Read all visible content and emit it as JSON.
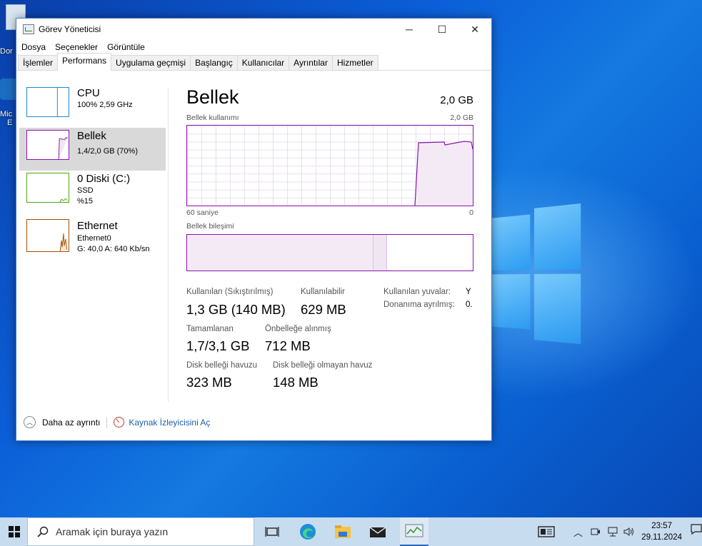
{
  "desktop": {
    "icon1_label": "Dor",
    "icon2_label": "Mic",
    "icon2_label2": "E"
  },
  "window": {
    "title": "Görev Yöneticisi",
    "controls": {
      "minimize": "─",
      "maximize": "☐",
      "close": "✕"
    }
  },
  "menu": [
    "Dosya",
    "Seçenekler",
    "Görüntüle"
  ],
  "tabs": [
    "İşlemler",
    "Performans",
    "Uygulama geçmişi",
    "Başlangıç",
    "Kullanıcılar",
    "Ayrıntılar",
    "Hizmetler"
  ],
  "active_tab": "Performans",
  "sidebar": [
    {
      "name": "CPU",
      "sub1": "100%  2,59 GHz",
      "sub2": "",
      "color": "#1a8ccc"
    },
    {
      "name": "Bellek",
      "sub1": "1,4/2,0 GB (70%)",
      "sub2": "",
      "color": "#8b12ae"
    },
    {
      "name": "0 Diski (C:)",
      "sub1": "SSD",
      "sub2": "%15",
      "color": "#4da60c"
    },
    {
      "name": "Ethernet",
      "sub1": "Ethernet0",
      "sub2": "G: 40,0  A: 640 Kb/sn",
      "color": "#a74f01"
    }
  ],
  "main": {
    "title": "Bellek",
    "capacity": "2,0 GB",
    "usage_label": "Bellek kullanımı",
    "usage_max": "2,0 GB",
    "x_left": "60 saniye",
    "x_right": "0",
    "composition_label": "Bellek bileşimi",
    "stats": [
      {
        "label": "Kullanılan (Sıkıştırılmış)",
        "value": "1,3 GB (140 MB)"
      },
      {
        "label": "Kullanılabilir",
        "value": "629 MB"
      },
      {
        "label": "Tamamlanan",
        "value": "1,7/3,1 GB"
      },
      {
        "label": "Önbelleğe alınmış",
        "value": "712 MB"
      },
      {
        "label": "Disk belleği havuzu",
        "value": "323 MB"
      },
      {
        "label": "Disk belleği olmayan havuz",
        "value": "148 MB"
      }
    ],
    "right_stats": [
      {
        "label": "Kullanılan yuvalar:",
        "value": "Y"
      },
      {
        "label": "Donanıma ayrılmış:",
        "value": "0."
      }
    ]
  },
  "footer": {
    "fewer_details": "Daha az ayrıntı",
    "resource_monitor": "Kaynak İzleyicisini Aç"
  },
  "taskbar": {
    "search_placeholder": "Aramak için buraya yazın",
    "time": "23:57",
    "date": "29.11.2024"
  }
}
